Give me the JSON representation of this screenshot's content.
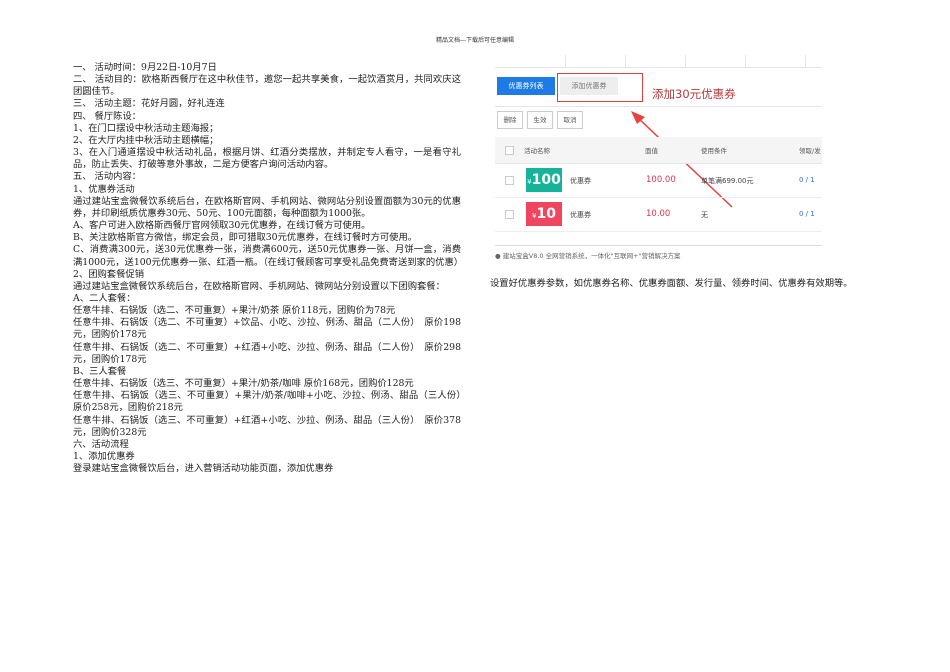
{
  "header": "精品文档---下载后可任意编辑",
  "paragraphs": [
    "一、 活动时间：9月22日-10月7日",
    "二、 活动目的：欧格斯西餐厅在这中秋佳节，邀您一起共享美食，一起饮酒赏月，共同欢庆这团圆佳节。",
    "三、 活动主题：花好月圆，好礼连连",
    "四、 餐厅陈设：",
    "1、在门口摆设中秋活动主题海报；",
    "2、在大厅内挂中秋活动主题横幅；",
    "3、在入门通道摆设中秋活动礼品，根据月饼、红酒分类摆放，并制定专人看守，一是看守礼品，防止丢失、打破等意外事故，二是方便客户询问活动内容。",
    "五、 活动内容：",
    "1、优惠券活动",
    "通过建站宝盒微餐饮系统后台，在欧格斯官网、手机网站、微网站分别设置面额为30元的优惠券，并印刷纸质优惠券30元、50元、100元面额，每种面额为1000张。",
    "A、客户可进入欧格斯西餐厅官网领取30元优惠券，在线订餐方可使用。",
    "B、关注欧格斯官方微信，绑定会员，即可猎取30元优惠券，在线订餐时方可使用。",
    "C、消费满300元，送30元优惠券一张，消费满600元，送50元优惠券一张、月饼一盒，消费满1000元，送100元优惠券一张、红酒一瓶。（在线订餐顾客可享受礼品免费寄送到家的优惠）",
    "2、团购套餐促销",
    "通过建站宝盒微餐饮系统后台，在欧格斯官网、手机网站、微网站分别设置以下团购套餐：",
    "A、二人套餐：",
    "任意牛排、石锅饭（选二、不可重复）+果汁/奶茶 原价118元，团购价为78元",
    "任意牛排、石锅饭（选二、不可重复）+饮品、小吃、沙拉、例汤、甜品（二人份）　原价198元，团购价178元",
    "任意牛排、石锅饭（选二、不可重复）+红酒+小吃、沙拉、例汤、甜品（二人份）　原价298元，团购价178元",
    "B、三人套餐",
    "任意牛排、石锅饭（选三、不可重复）+果汁/奶茶/咖啡 原价168元，团购价128元",
    "任意牛排、石锅饭（选三、不可重复）+果汁/奶茶/咖啡+小吃、沙拉、例汤、甜品（三人份）　原价258元，团购价218元",
    "任意牛排、石锅饭（选三、不可重复）+红酒+小吃、沙拉、例汤、甜品（三人份）　原价378元，团购价328元",
    "六、活动流程",
    "1、添加优惠券",
    "登录建站宝盒微餐饮后台，进入营销活动功能页面，添加优惠券"
  ],
  "screenshot": {
    "tab_list": "优惠券列表",
    "tab_add": "添加优惠券",
    "annotation": "添加30元优惠券",
    "actions": [
      "删除",
      "生效",
      "取消"
    ],
    "columns": [
      "活动名称",
      "面值",
      "使用条件",
      "领取/发"
    ],
    "rows": [
      {
        "badge": "100",
        "currency": "¥",
        "name": "优惠券",
        "value": "100.00",
        "condition": "单笔满699.00元",
        "count": "0 / 1",
        "color": "#14b39a"
      },
      {
        "badge": "10",
        "currency": "¥",
        "name": "优惠券",
        "value": "10.00",
        "condition": "无",
        "count": "0 / 1",
        "color": "#f0455e"
      }
    ],
    "footer": "建站宝盒V8.0 全网营销系统，一体化\"互联网+\"营销解决方案"
  },
  "caption": "设置好优惠券参数，如优惠券名称、优惠券面额、发行量、领券时间、优惠券有效期等。"
}
